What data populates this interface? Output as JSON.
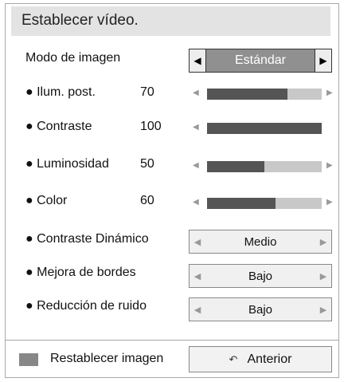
{
  "title": "Establecer vídeo.",
  "mode": {
    "label": "Modo de imagen",
    "value": "Estándar"
  },
  "sliders": [
    {
      "label": "● Ilum. post.",
      "value": "70",
      "level": 0.7
    },
    {
      "label": "● Contraste",
      "value": "100",
      "level": 1.0
    },
    {
      "label": "● Luminosidad",
      "value": "50",
      "level": 0.5
    },
    {
      "label": "● Color",
      "value": "60",
      "level": 0.6
    }
  ],
  "options": [
    {
      "label": "● Contraste Dinámico",
      "value": "Medio"
    },
    {
      "label": "● Mejora de bordes",
      "value": "Bajo"
    },
    {
      "label": "● Reducción de ruido",
      "value": "Bajo"
    }
  ],
  "footer": {
    "reset_label": "Restablecer imagen",
    "back_label": "Anterior"
  },
  "icons": {
    "left": "◀",
    "right": "▶",
    "back": "back-arrow-icon"
  }
}
